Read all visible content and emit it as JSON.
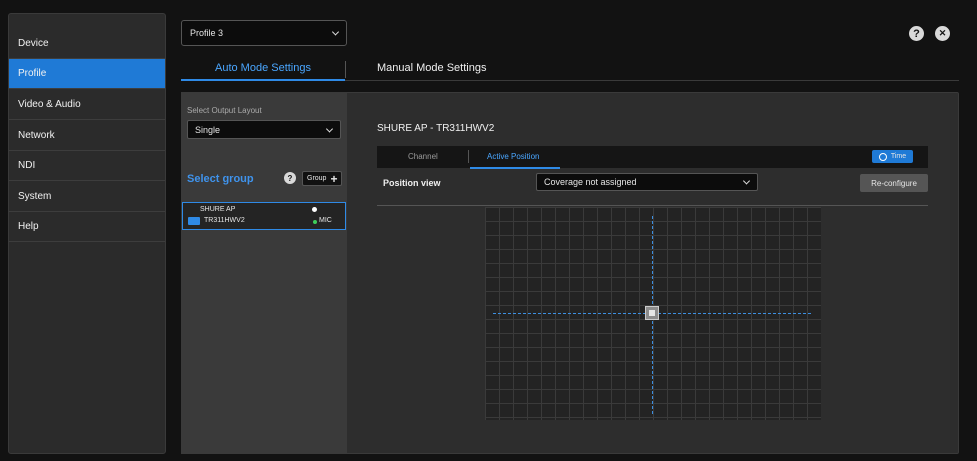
{
  "sidebar": {
    "items": [
      {
        "label": "Device",
        "active": false
      },
      {
        "label": "Profile",
        "active": true
      },
      {
        "label": "Video & Audio",
        "active": false
      },
      {
        "label": "Network",
        "active": false
      },
      {
        "label": "NDI",
        "active": false
      },
      {
        "label": "System",
        "active": false
      },
      {
        "label": "Help",
        "active": false
      }
    ]
  },
  "header": {
    "profile_select_value": "Profile 3",
    "help_icon_glyph": "?",
    "close_icon_glyph": "✕"
  },
  "tabs": {
    "auto": "Auto Mode Settings",
    "manual": "Manual Mode Settings"
  },
  "left_panel": {
    "output_layout_label": "Select Output Layout",
    "output_layout_value": "Single",
    "select_group_label": "Select group",
    "group_help_glyph": "?",
    "group_button_label": "Group",
    "group_button_plus": "+",
    "device": {
      "name": "SHURE AP",
      "model": "TR311HWV2",
      "status": "MIC",
      "status_color": "#3ecf5a",
      "enabled": true
    }
  },
  "main": {
    "device_title": "SHURE AP - TR311HWV2",
    "sub_tabs": [
      "Channel",
      "Active Position"
    ],
    "active_sub_tab": "Active Position",
    "time_button_label": "Time",
    "position_view_label": "Position view",
    "coverage_select_value": "Coverage not assigned",
    "reconfigure_label": "Re-configure"
  },
  "colors": {
    "accent": "#1f7ad6",
    "link_blue": "#4aa6ff",
    "background": "#121212"
  }
}
